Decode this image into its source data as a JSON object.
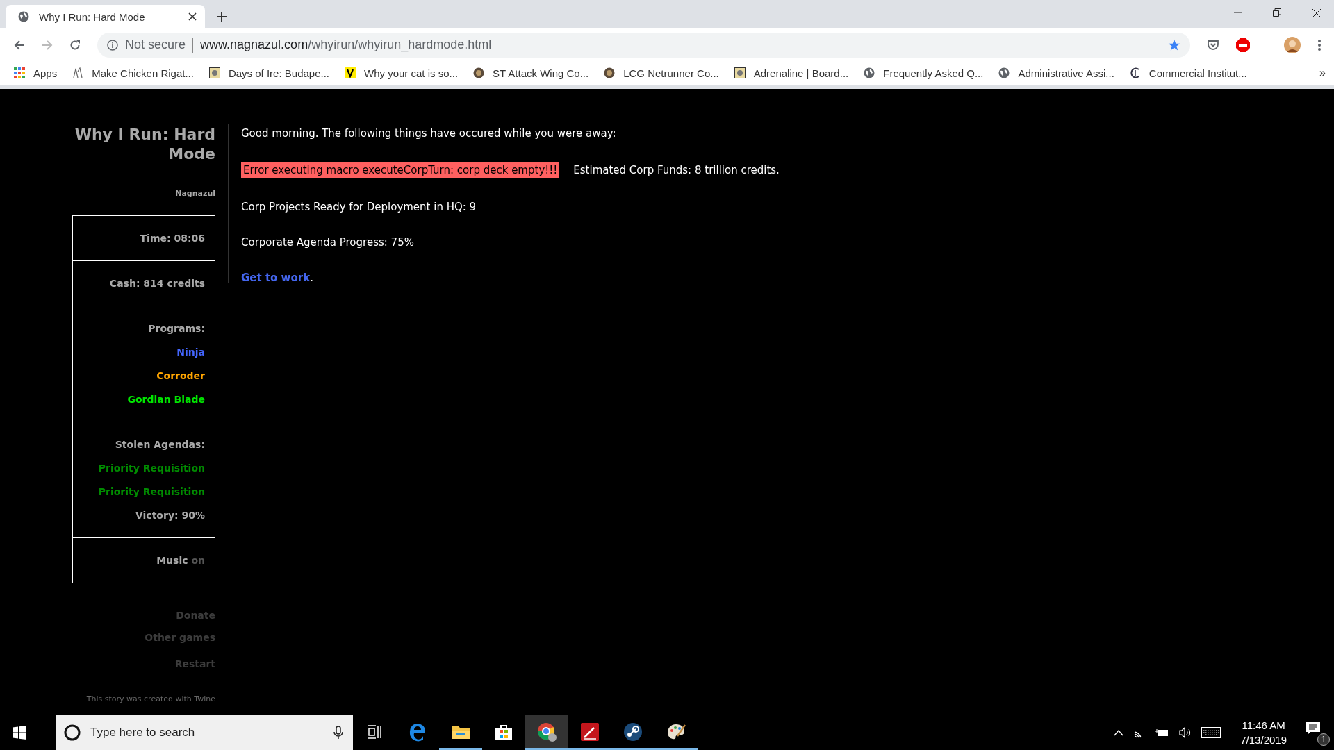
{
  "browser": {
    "tab": {
      "title": "Why I Run: Hard Mode"
    },
    "address": {
      "security": "Not secure",
      "host": "www.nagnazul.com",
      "path": "/whyirun/whyirun_hardmode.html"
    },
    "bookmarks": [
      {
        "kind": "apps",
        "label": "Apps"
      },
      {
        "kind": "sketch",
        "label": "Make Chicken Rigat..."
      },
      {
        "kind": "tile",
        "label": "Days of Ire: Budape..."
      },
      {
        "kind": "letter",
        "label": "Why your cat is so..."
      },
      {
        "kind": "coin",
        "label": "ST Attack Wing Co..."
      },
      {
        "kind": "coin",
        "label": "LCG Netrunner Co..."
      },
      {
        "kind": "tile",
        "label": "Adrenaline | Board..."
      },
      {
        "kind": "globe",
        "label": "Frequently Asked Q..."
      },
      {
        "kind": "globe",
        "label": "Administrative Assi..."
      },
      {
        "kind": "crest",
        "label": "Commercial Institut..."
      }
    ],
    "more": "»"
  },
  "sidebar": {
    "title": "Why I Run: Hard Mode",
    "author": "Nagnazul",
    "time": "Time: 08:06",
    "cash": "Cash: 814 credits",
    "programs": {
      "heading": "Programs:",
      "items": [
        {
          "name": "Ninja",
          "color": "#4466ff"
        },
        {
          "name": "Corroder",
          "color": "#ffa500"
        },
        {
          "name": "Gordian Blade",
          "color": "#00e600"
        }
      ]
    },
    "agendas": {
      "heading": "Stolen Agendas:",
      "items": [
        {
          "name": "Priority Requisition",
          "color": "#008c00"
        },
        {
          "name": "Priority Requisition",
          "color": "#008c00"
        }
      ],
      "victory": "Victory: 90%"
    },
    "music": {
      "label": "Music",
      "toggle": "on"
    },
    "links": [
      "Donate",
      "Other games",
      "Restart"
    ],
    "credit": "This story was created with Twine"
  },
  "main": {
    "greeting": "Good morning. The following things have occured while you were away:",
    "error": "Error executing macro executeCorpTurn: corp deck empty!!!",
    "funds": "Estimated Corp Funds: 8 trillion credits.",
    "projects": "Corp Projects Ready for Deployment in HQ: 9",
    "progress": "Corporate Agenda Progress: 75%",
    "link": "Get to work",
    "link_after": "."
  },
  "taskbar": {
    "search": {
      "placeholder": "Type here to search"
    },
    "apps": [
      {
        "kind": "taskview",
        "running": false,
        "selected": false
      },
      {
        "kind": "edge",
        "running": false,
        "selected": false
      },
      {
        "kind": "folder",
        "running": true,
        "selected": false
      },
      {
        "kind": "store",
        "running": false,
        "selected": false
      },
      {
        "kind": "chrome",
        "running": true,
        "selected": true
      },
      {
        "kind": "pdf",
        "running": true,
        "selected": false
      },
      {
        "kind": "steam",
        "running": true,
        "selected": false
      },
      {
        "kind": "paint",
        "running": true,
        "selected": false
      }
    ],
    "time": "11:46 AM",
    "date": "7/13/2019",
    "notifications": "1"
  }
}
